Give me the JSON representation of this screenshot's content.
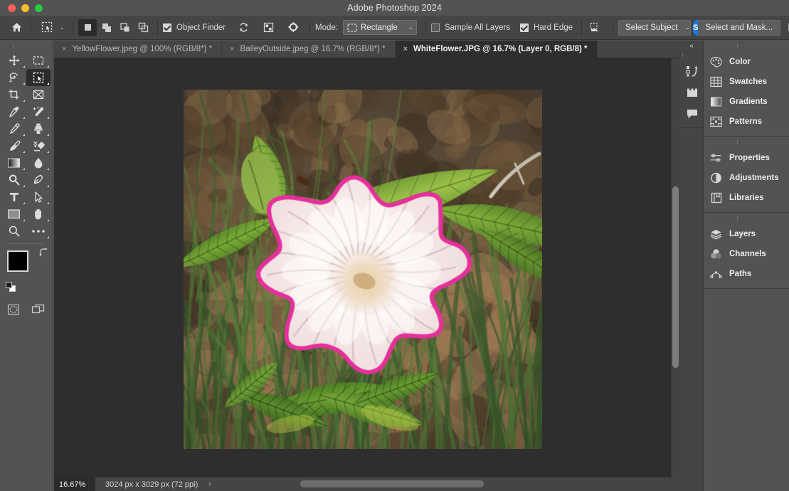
{
  "window": {
    "title": "Adobe Photoshop 2024",
    "traffic_lights": [
      "close",
      "minimize",
      "zoom"
    ]
  },
  "options_bar": {
    "home_icon": "home-icon",
    "active_tool_icon": "object-selection-tool-icon",
    "tool_caret": "⌄",
    "selection_modes": [
      {
        "name": "new-selection",
        "label": "New selection",
        "active": true
      },
      {
        "name": "add-to-selection",
        "label": "Add to selection",
        "active": false
      },
      {
        "name": "subtract-from-selection",
        "label": "Subtract from selection",
        "active": false
      },
      {
        "name": "intersect-with-selection",
        "label": "Intersect with selection",
        "active": false
      }
    ],
    "object_finder": {
      "label": "Object Finder",
      "checked": true
    },
    "refresh_icon": "refresh-icon",
    "show_overlay_icon": "show-object-overlay-icon",
    "settings_icon": "gear-icon",
    "mode": {
      "label": "Mode:",
      "value": "Rectangle",
      "icon": "marquee-rectangle-icon",
      "caret": "⌄"
    },
    "sample_all_layers": {
      "label": "Sample All Layers",
      "checked": false
    },
    "hard_edge": {
      "label": "Hard Edge",
      "checked": true
    },
    "feather_icon": "select-subject-device-icon",
    "select_subject": {
      "label": "Select Subject",
      "caret": "⌄"
    },
    "select_and_mask": {
      "badge": "S",
      "label": "Select and Mask..."
    },
    "mask_preview_icon": "mask-preview-icon",
    "overflow_caret": "⌄"
  },
  "tabs": [
    {
      "title": "YellowFlower.jpeg @ 100% (RGB/8*) *",
      "close": "×",
      "active": false
    },
    {
      "title": "BaileyOutside.jpeg @ 16.7% (RGB/8*) *",
      "close": "×",
      "active": false
    },
    {
      "title": "WhiteFlower.JPG @ 16.7% (Layer 0, RGB/8) *",
      "close": "×",
      "active": true
    }
  ],
  "toolbar": {
    "tools": [
      {
        "name": "move-tool",
        "icon": "move-icon",
        "selected": false,
        "has_flyout": true
      },
      {
        "name": "rectangular-marquee-tool",
        "icon": "marquee-rect-icon",
        "selected": false,
        "has_flyout": true
      },
      {
        "name": "lasso-tool",
        "icon": "lasso-icon",
        "selected": false,
        "has_flyout": true
      },
      {
        "name": "object-selection-tool",
        "icon": "object-selection-icon",
        "selected": true,
        "has_flyout": true
      },
      {
        "name": "crop-tool",
        "icon": "crop-icon",
        "selected": false,
        "has_flyout": true
      },
      {
        "name": "frame-tool",
        "icon": "frame-icon",
        "selected": false,
        "has_flyout": false
      },
      {
        "name": "eyedropper-tool",
        "icon": "eyedropper-icon",
        "selected": false,
        "has_flyout": true
      },
      {
        "name": "spot-healing-brush-tool",
        "icon": "healing-brush-icon",
        "selected": false,
        "has_flyout": true
      },
      {
        "name": "brush-tool",
        "icon": "brush-icon",
        "selected": false,
        "has_flyout": true
      },
      {
        "name": "clone-stamp-tool",
        "icon": "clone-stamp-icon",
        "selected": false,
        "has_flyout": true
      },
      {
        "name": "history-brush-tool",
        "icon": "history-brush-icon",
        "selected": false,
        "has_flyout": true
      },
      {
        "name": "eraser-tool",
        "icon": "eraser-icon",
        "selected": false,
        "has_flyout": true
      },
      {
        "name": "gradient-tool",
        "icon": "gradient-icon",
        "selected": false,
        "has_flyout": true
      },
      {
        "name": "blur-tool",
        "icon": "blur-droplet-icon",
        "selected": false,
        "has_flyout": true
      },
      {
        "name": "dodge-tool",
        "icon": "dodge-icon",
        "selected": false,
        "has_flyout": true
      },
      {
        "name": "pen-tool",
        "icon": "pen-icon",
        "selected": false,
        "has_flyout": true
      },
      {
        "name": "type-tool",
        "icon": "type-t-icon",
        "selected": false,
        "has_flyout": true
      },
      {
        "name": "path-selection-tool",
        "icon": "path-arrow-icon",
        "selected": false,
        "has_flyout": true
      },
      {
        "name": "rectangle-tool",
        "icon": "shape-rectangle-icon",
        "selected": false,
        "has_flyout": true
      },
      {
        "name": "hand-tool",
        "icon": "hand-icon",
        "selected": false,
        "has_flyout": true
      },
      {
        "name": "zoom-tool",
        "icon": "magnifier-icon",
        "selected": false,
        "has_flyout": false
      },
      {
        "name": "edit-toolbar",
        "icon": "ellipsis-icon",
        "selected": false,
        "has_flyout": true
      }
    ],
    "foreground_color": "#000000",
    "background_color": "#ffffff",
    "swap_icon": "swap-colors-icon",
    "default_colors_icon": "default-colors-icon",
    "quick_mask_icon": "quick-mask-icon",
    "screen_mode_icon": "screen-mode-icon"
  },
  "document": {
    "filename": "WhiteFlower.JPG",
    "zoom": "16.67%",
    "dimensions": "3024 px x 3029 px (72 ppi)",
    "status_chevron": "›",
    "selection_outline_color": "#e5309c"
  },
  "rail": {
    "collapse_icon": "«",
    "items": [
      {
        "name": "history-panel-icon",
        "icon": "history-icon"
      },
      {
        "name": "actions-panel-icon",
        "icon": "actions-icon"
      },
      {
        "name": "comments-panel-icon",
        "icon": "comment-icon"
      }
    ]
  },
  "panels": [
    {
      "group": "color-group",
      "items": [
        {
          "name": "color-panel",
          "label": "Color",
          "icon": "palette-icon"
        },
        {
          "name": "swatches-panel",
          "label": "Swatches",
          "icon": "grid-icon"
        },
        {
          "name": "gradients-panel",
          "label": "Gradients",
          "icon": "gradient-swatch-icon"
        },
        {
          "name": "patterns-panel",
          "label": "Patterns",
          "icon": "pattern-icon"
        }
      ]
    },
    {
      "group": "properties-group",
      "items": [
        {
          "name": "properties-panel",
          "label": "Properties",
          "icon": "sliders-icon"
        },
        {
          "name": "adjustments-panel",
          "label": "Adjustments",
          "icon": "half-circle-icon"
        },
        {
          "name": "libraries-panel",
          "label": "Libraries",
          "icon": "book-icon"
        }
      ]
    },
    {
      "group": "layers-group",
      "items": [
        {
          "name": "layers-panel",
          "label": "Layers",
          "icon": "layers-stack-icon"
        },
        {
          "name": "channels-panel",
          "label": "Channels",
          "icon": "venn-circles-icon"
        },
        {
          "name": "paths-panel",
          "label": "Paths",
          "icon": "bezier-path-icon"
        }
      ]
    }
  ]
}
